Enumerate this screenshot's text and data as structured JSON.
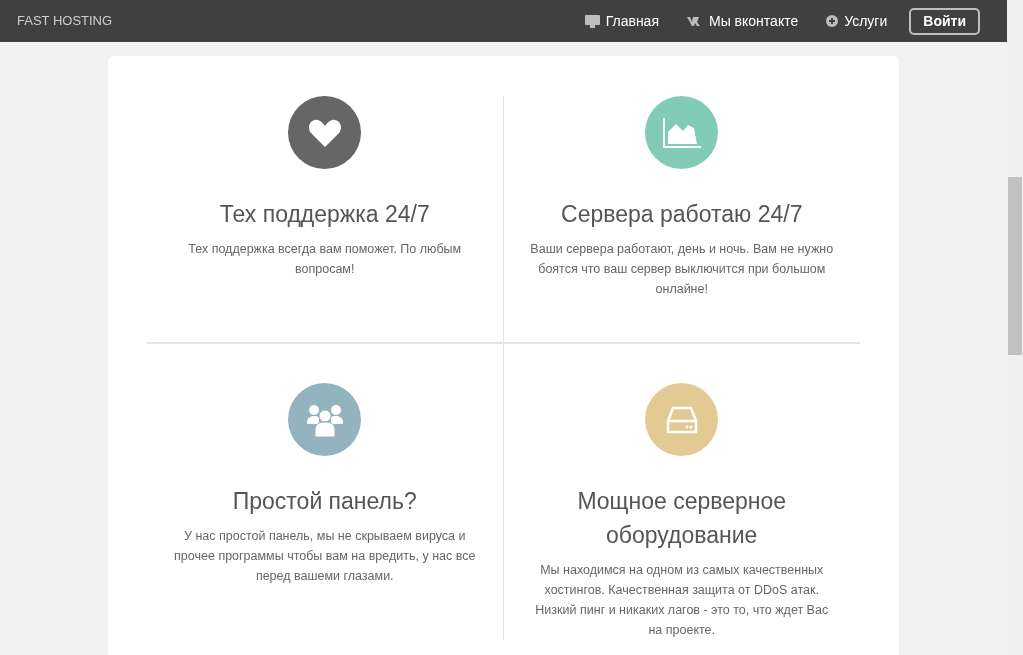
{
  "header": {
    "brand": "FAST HOSTING",
    "nav": [
      {
        "kind": "monitor",
        "label": "Главная"
      },
      {
        "kind": "vk",
        "label": "Мы вконтакте"
      },
      {
        "kind": "plus",
        "label": "Услуги"
      }
    ],
    "login": "Войти"
  },
  "features": [
    {
      "kind": "heart",
      "color": "#666666",
      "title": "Тех поддержка 24/7",
      "text": "Тех поддержка всегда вам поможет. По любым вопросам!"
    },
    {
      "kind": "chart",
      "color": "#82cbb7",
      "title": "Сервера работаю 24/7",
      "text": "Ваши сервера работают, день и ночь. Вам не нужно боятся что ваш сервер выключится при большом онлайне!"
    },
    {
      "kind": "users",
      "color": "#93b4bf",
      "title": "Простой панель?",
      "text": "У нас простой панель, мы не скрываем вируса и прочее программы чтобы вам на вредить, у нас все перед вашеми глазами."
    },
    {
      "kind": "drive",
      "color": "#e3ca95",
      "title": "Мощное серверное оборудование",
      "text": "Мы находимся на одном из самых качественных хостингов. Качественная защита от DDoS атак. Низкий пинг и никаких лагов - это то, что ждет Вас на проекте."
    }
  ]
}
